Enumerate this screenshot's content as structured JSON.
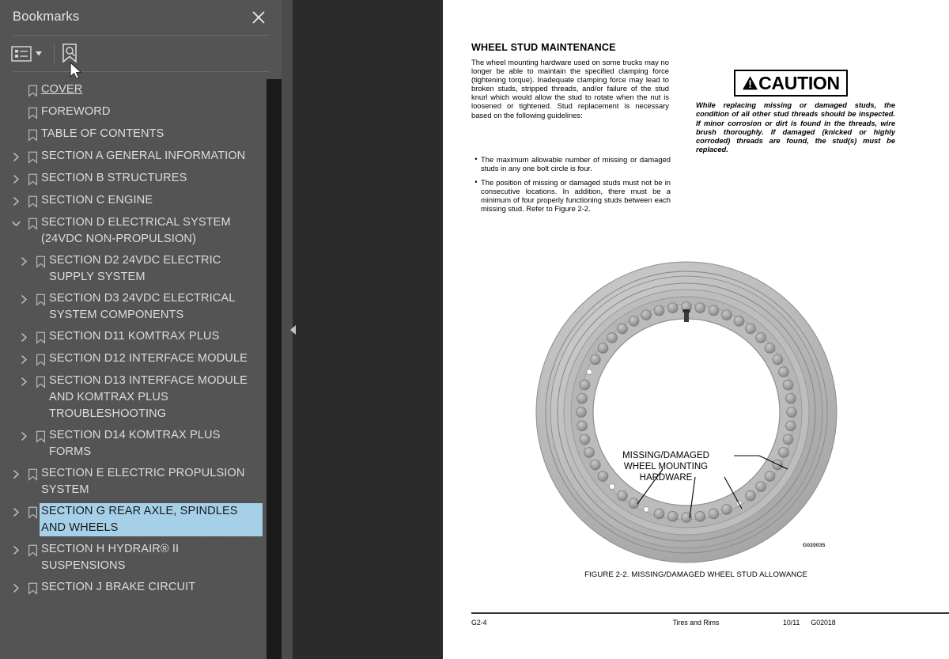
{
  "panel": {
    "title": "Bookmarks",
    "close_icon": "close-icon",
    "toolbar": {
      "list_options_icon": "list-options-icon",
      "list_options_caret_icon": "chevron-down-icon",
      "find_bookmark_icon": "find-bookmark-icon"
    },
    "collapse_handle_icon": "collapse-left-icon",
    "items": [
      {
        "label": "COVER",
        "level": 0,
        "twisty": "none",
        "state": "hovered"
      },
      {
        "label": "FOREWORD",
        "level": 0,
        "twisty": "none",
        "state": "normal"
      },
      {
        "label": "TABLE OF CONTENTS",
        "level": 0,
        "twisty": "none",
        "state": "normal"
      },
      {
        "label": "SECTION A GENERAL INFORMATION",
        "level": 0,
        "twisty": "collapsed",
        "state": "normal"
      },
      {
        "label": "SECTION B STRUCTURES",
        "level": 0,
        "twisty": "collapsed",
        "state": "normal"
      },
      {
        "label": "SECTION C ENGINE",
        "level": 0,
        "twisty": "collapsed",
        "state": "normal"
      },
      {
        "label": "SECTION D ELECTRICAL SYSTEM (24VDC NON-PROPULSION)",
        "level": 0,
        "twisty": "expanded",
        "state": "normal"
      },
      {
        "label": "SECTION D2 24VDC ELECTRIC SUPPLY SYSTEM",
        "level": 1,
        "twisty": "collapsed",
        "state": "normal"
      },
      {
        "label": "SECTION D3 24VDC ELECTRICAL SYSTEM COMPONENTS",
        "level": 1,
        "twisty": "collapsed",
        "state": "normal"
      },
      {
        "label": "SECTION D11 KOMTRAX PLUS",
        "level": 1,
        "twisty": "collapsed",
        "state": "normal"
      },
      {
        "label": "SECTION D12 INTERFACE MODULE",
        "level": 1,
        "twisty": "collapsed",
        "state": "normal"
      },
      {
        "label": "SECTION D13 INTERFACE MODULE AND KOMTRAX PLUS TROUBLESHOOTING",
        "level": 1,
        "twisty": "collapsed",
        "state": "normal"
      },
      {
        "label": "SECTION D14 KOMTRAX PLUS FORMS",
        "level": 1,
        "twisty": "collapsed",
        "state": "normal"
      },
      {
        "label": "SECTION E ELECTRIC PROPULSION SYSTEM",
        "level": 0,
        "twisty": "collapsed",
        "state": "normal"
      },
      {
        "label": "SECTION G REAR AXLE, SPINDLES AND WHEELS",
        "level": 0,
        "twisty": "collapsed",
        "state": "selected"
      },
      {
        "label": "SECTION H HYDRAIR® II SUSPENSIONS",
        "level": 0,
        "twisty": "collapsed",
        "state": "normal"
      },
      {
        "label": "SECTION J BRAKE CIRCUIT",
        "level": 0,
        "twisty": "collapsed",
        "state": "normal"
      }
    ],
    "scrollbar": {
      "name": "bookmarks-scrollbar"
    },
    "colors": {
      "panel_bg": "#545454",
      "text": "#dcdcdc",
      "selection": "#a6d0e8",
      "scroll_thumb": "#c9c9c9"
    }
  },
  "document": {
    "heading": "WHEEL STUD MAINTENANCE",
    "intro": "The wheel mounting hardware used on some trucks may no longer be able to maintain the specified clamping force (tightening torque). Inadequate clamping force may lead to broken studs, stripped threads, and/or failure of the stud knurl which would allow the stud to rotate when the nut is loosened or tightened. Stud replacement is necessary based on the following guidelines:",
    "bullets": [
      "The maximum allowable number of missing or damaged studs in any one bolt circle is four.",
      "The position of missing or damaged studs must not be in consecutive locations.  In addition, there must be a minimum of four properly functioning studs between each missing stud. Refer to Figure 2-2."
    ],
    "caution": {
      "symbol_icon": "warning-triangle-icon",
      "word": "CAUTION",
      "text": "While replacing missing or damaged studs, the condition of all other stud threads should be inspected.  If minor corrosion or dirt is found in the threads, wire brush thoroughly.  If damaged (knicked or highly corroded) threads are found, the stud(s) must be replaced."
    },
    "figure": {
      "callout_lines": [
        "MISSING/DAMAGED",
        "WHEEL MOUNTING",
        "HARDWARE"
      ],
      "code": "G020035",
      "caption": "FIGURE 2-2. MISSING/DAMAGED WHEEL STUD ALLOWANCE"
    },
    "footer": {
      "left": "G2-4",
      "center": "Tires and Rims",
      "right_date": "10/11",
      "right_code": "G02018"
    }
  }
}
